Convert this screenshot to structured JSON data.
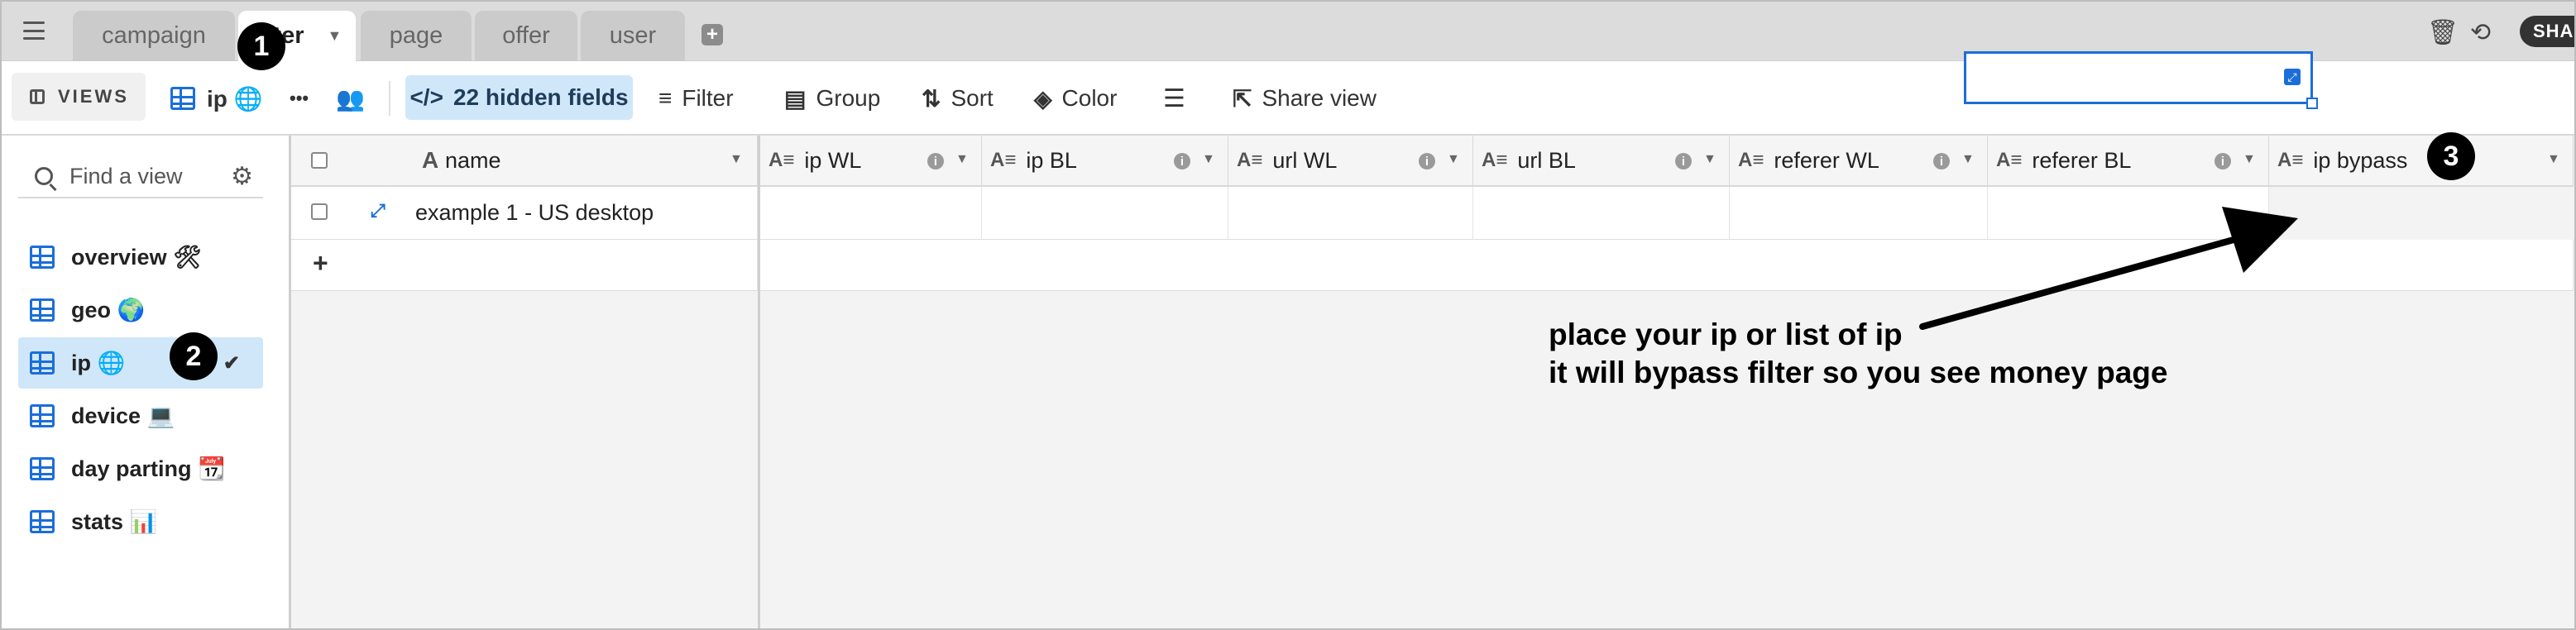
{
  "tabs": [
    {
      "label": "campaign"
    },
    {
      "label": "filter"
    },
    {
      "label": "page"
    },
    {
      "label": "offer"
    },
    {
      "label": "user"
    }
  ],
  "top_right": {
    "share_label": "SHA"
  },
  "toolbar": {
    "views_label": "VIEWS",
    "current_view_name": "ip 🌐",
    "more_label": "•••",
    "hidden_fields_label": "22 hidden fields",
    "filter_label": "Filter",
    "group_label": "Group",
    "sort_label": "Sort",
    "color_label": "Color",
    "share_view_label": "Share view"
  },
  "sidebar": {
    "find_placeholder": "Find a view",
    "views": [
      {
        "label": "overview 🛠"
      },
      {
        "label": "geo 🌍"
      },
      {
        "label": "ip 🌐"
      },
      {
        "label": "device 💻"
      },
      {
        "label": "day parting 📆"
      },
      {
        "label": "stats 📊"
      }
    ]
  },
  "grid": {
    "columns": [
      {
        "label": "name"
      },
      {
        "label": "ip WL"
      },
      {
        "label": "ip BL"
      },
      {
        "label": "url WL"
      },
      {
        "label": "url BL"
      },
      {
        "label": "referer WL"
      },
      {
        "label": "referer BL"
      },
      {
        "label": "ip bypass"
      }
    ],
    "rows": [
      {
        "name": "example 1 - US desktop"
      }
    ],
    "add_row_label": "+"
  },
  "annotations": {
    "markers": [
      "1",
      "2",
      "3"
    ],
    "note_line1": "place your ip or list of ip",
    "note_line2": "it will bypass filter so you  see money page"
  },
  "colors": {
    "accent": "#1b6ed9",
    "selected_bg": "#cfe7f9"
  }
}
